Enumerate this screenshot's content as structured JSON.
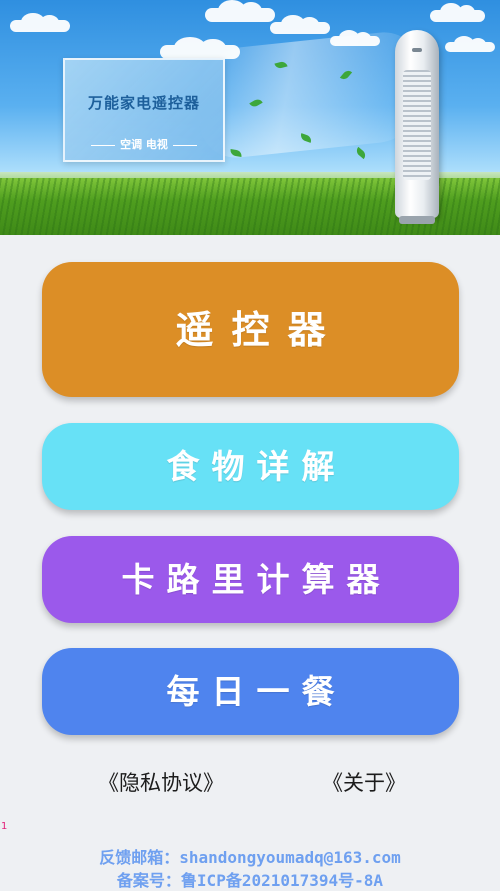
{
  "banner": {
    "sign_title": "万能家电遥控器",
    "sign_subtitle": "空调 电视"
  },
  "buttons": {
    "remote": "遥控器",
    "food": "食物详解",
    "calorie": "卡路里计算器",
    "meal": "每日一餐"
  },
  "links": {
    "privacy": "《隐私协议》",
    "about": "《关于》"
  },
  "marker": "1",
  "footer": {
    "email": "反馈邮箱：shandongyoumadq@163.com",
    "icp": "备案号：鲁ICP备2021017394号-8A"
  },
  "colors": {
    "remote": "#dc8e26",
    "food": "#67e1f6",
    "calorie": "#9b59eb",
    "meal": "#4f84ee",
    "footer_text": "#6fa0f0"
  }
}
